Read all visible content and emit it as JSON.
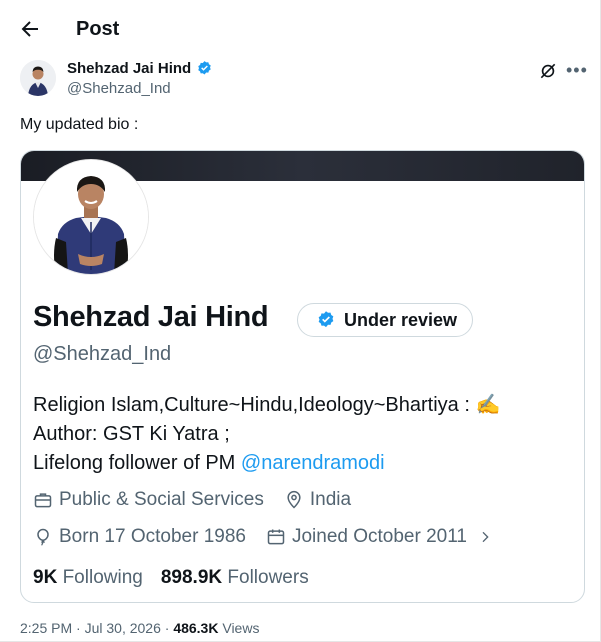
{
  "header": {
    "title": "Post"
  },
  "author": {
    "name": "Shehzad Jai Hind",
    "handle": "@Shehzad_Ind"
  },
  "post": {
    "text": "My updated bio :"
  },
  "profile_card": {
    "name": "Shehzad Jai Hind",
    "badge_label": "Under review",
    "handle": "@Shehzad_Ind",
    "bio_line1": "Religion Islam,Culture~Hindu,Ideology~Bhartiya : ✍️",
    "bio_line2": "Author: GST Ki Yatra ;",
    "bio_line3_prefix": "Lifelong follower of PM ",
    "bio_mention": "@narendramodi",
    "category": "Public & Social Services",
    "location": "India",
    "born": "Born 17 October 1986",
    "joined": "Joined October 2011",
    "following_count": "9K",
    "following_label": "Following",
    "followers_count": "898.9K",
    "followers_label": "Followers"
  },
  "footer": {
    "timestamp": "2:25 PM · Jul 30, 2026 · ",
    "views_count": "486.3K",
    "views_label": " Views"
  },
  "colors": {
    "accent": "#1d9bf0",
    "muted": "#536471",
    "text": "#0f1419"
  }
}
